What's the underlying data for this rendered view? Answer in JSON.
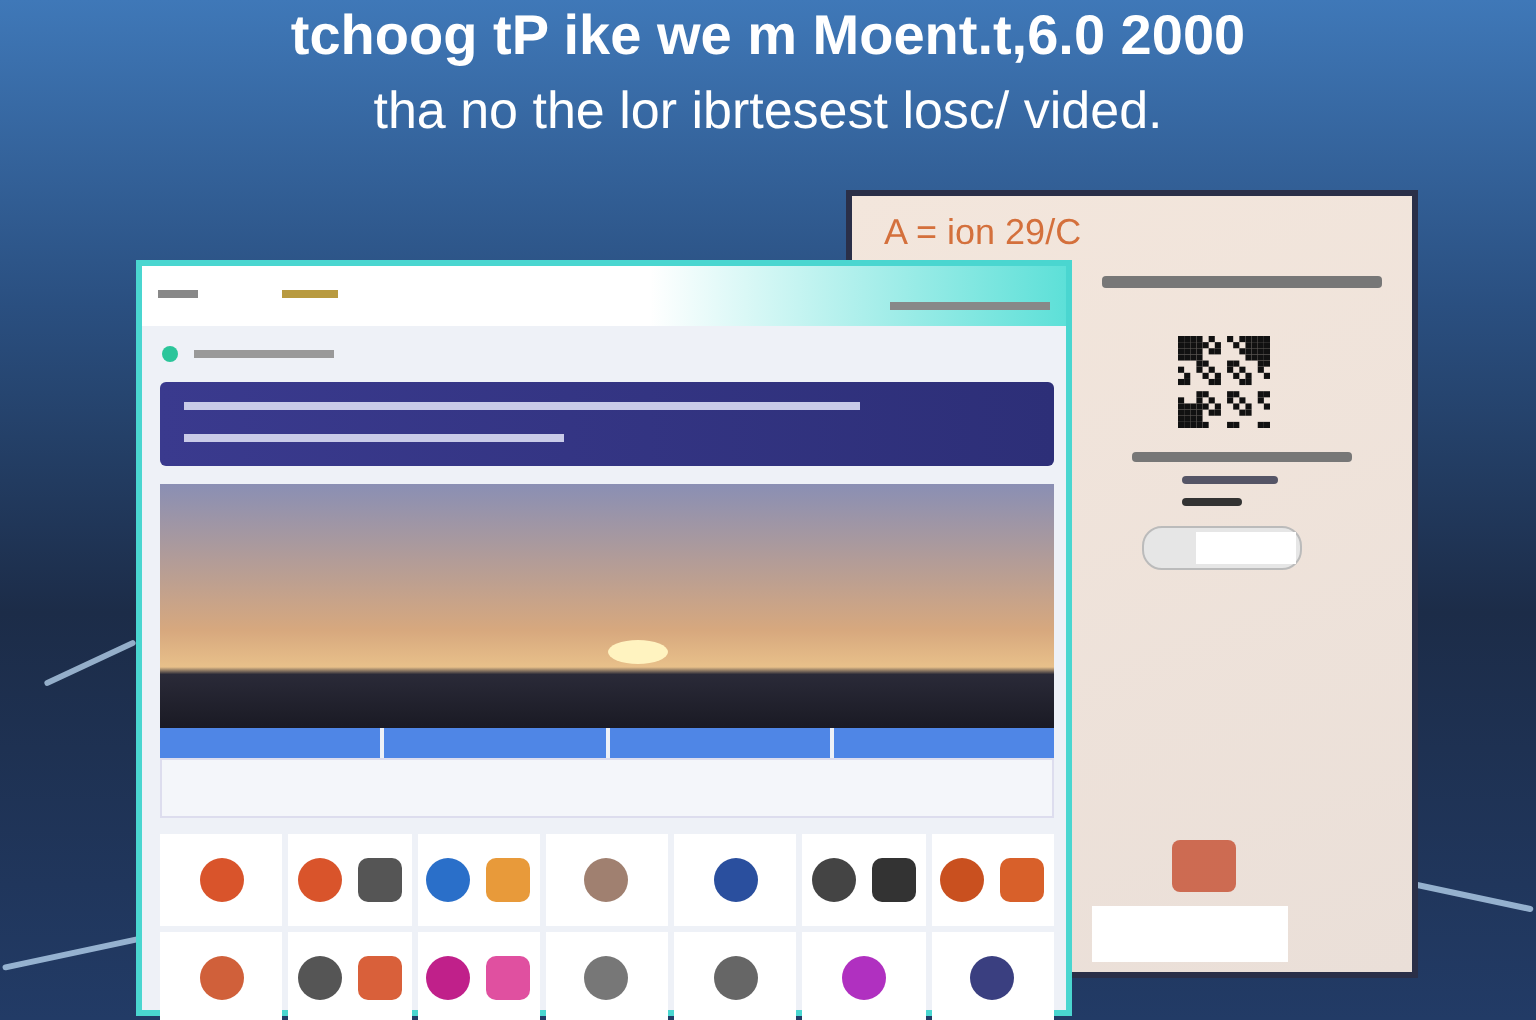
{
  "headline": "tchoog tP ike we m Moent.t,6.0 2000",
  "subtitle": "tha no the lor ibrtesest losc/ vided.",
  "back_card": {
    "title": "A = ion 29/C"
  },
  "app_window": {
    "tiles": [
      {
        "icons": [
          {
            "color": "#d9542b"
          }
        ]
      },
      {
        "icons": [
          {
            "color": "#d9542b"
          },
          {
            "color": "#555555"
          }
        ]
      },
      {
        "icons": [
          {
            "color": "#2a6fc9"
          },
          {
            "color": "#e89a3a"
          }
        ]
      },
      {
        "icons": [
          {
            "color": "#a08070"
          }
        ]
      },
      {
        "icons": [
          {
            "color": "#2a4f9e"
          }
        ]
      },
      {
        "icons": [
          {
            "color": "#444444"
          },
          {
            "color": "#333333"
          }
        ]
      },
      {
        "icons": [
          {
            "color": "#c9501f"
          },
          {
            "color": "#d8602a"
          }
        ]
      },
      {
        "icons": [
          {
            "color": "#d0603a"
          }
        ]
      },
      {
        "icons": [
          {
            "color": "#555555"
          },
          {
            "color": "#d9603a"
          }
        ]
      },
      {
        "icons": [
          {
            "color": "#c0208a"
          },
          {
            "color": "#e050a0"
          }
        ]
      },
      {
        "icons": [
          {
            "color": "#777777"
          }
        ]
      },
      {
        "icons": [
          {
            "color": "#666666"
          }
        ]
      },
      {
        "icons": [
          {
            "color": "#b030c0"
          }
        ]
      },
      {
        "icons": [
          {
            "color": "#3a3f80"
          }
        ]
      }
    ]
  }
}
